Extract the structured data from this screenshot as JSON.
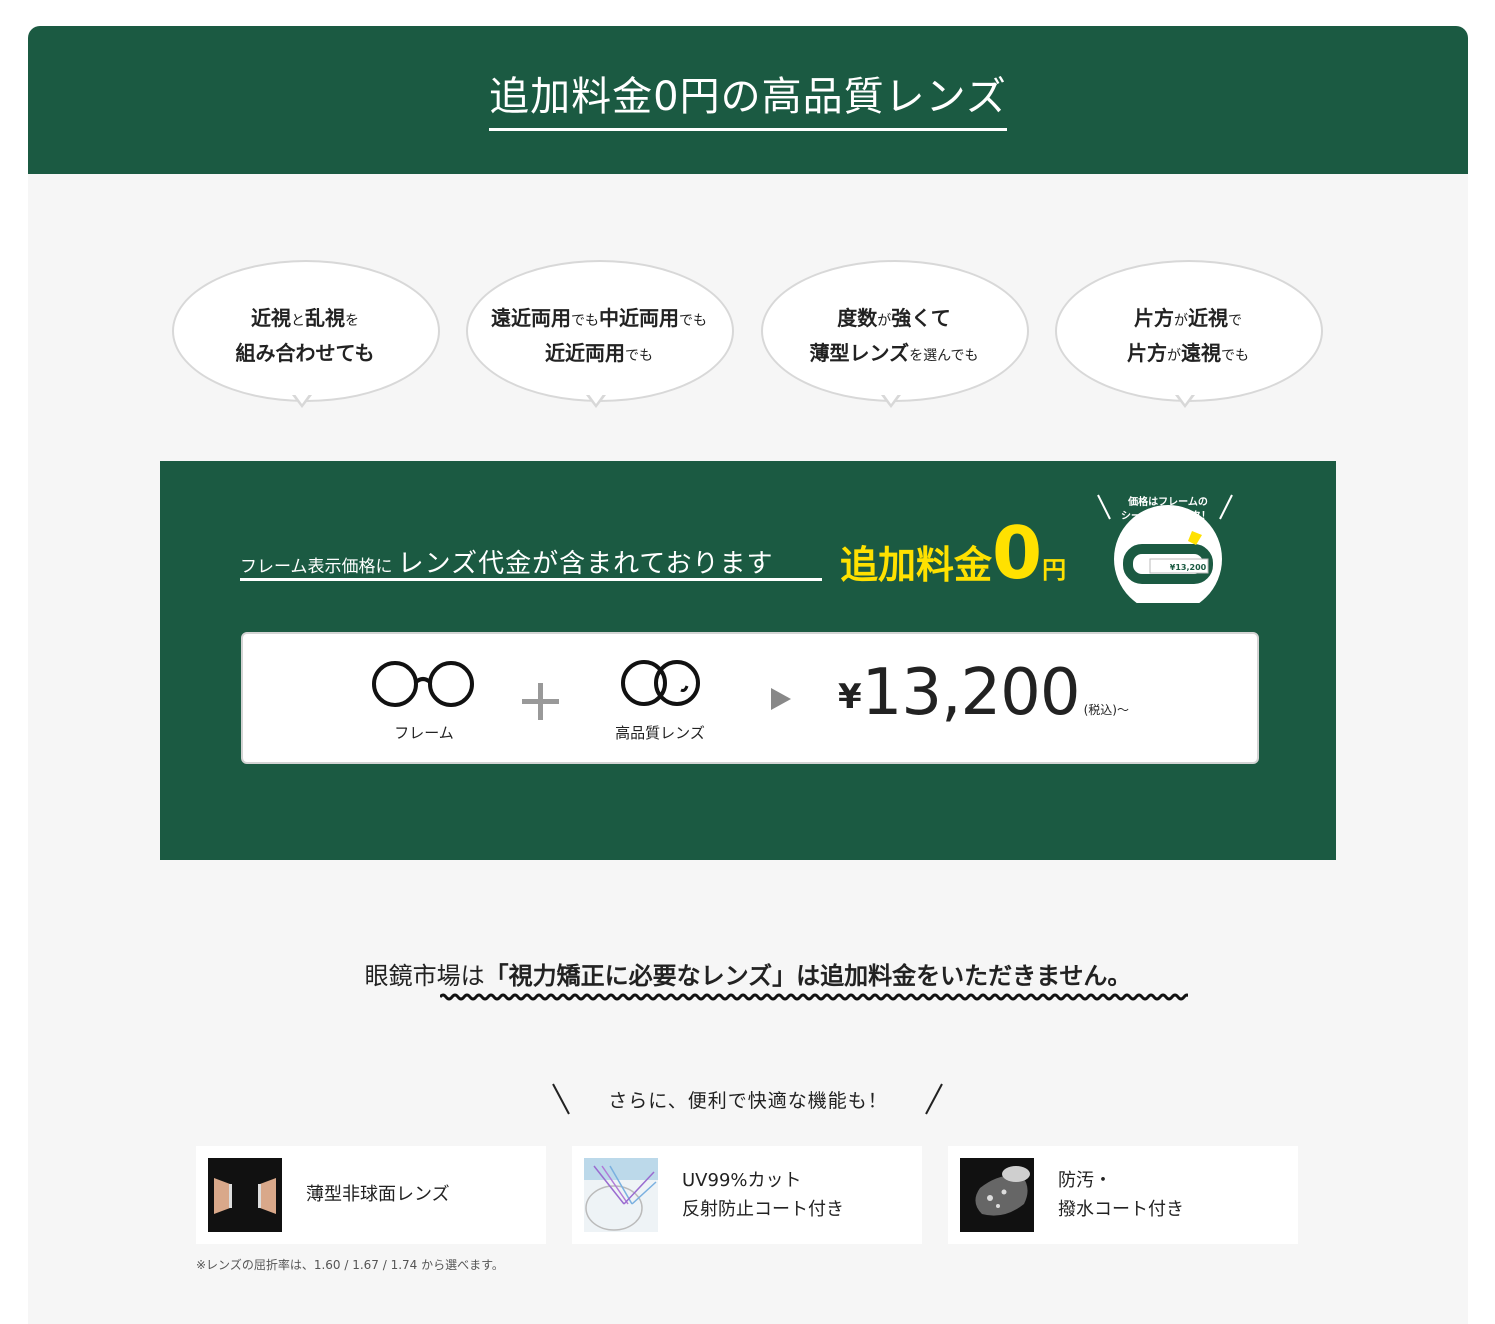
{
  "header": {
    "title": "追加料金0円の高品質レンズ"
  },
  "bubbles": [
    {
      "line1_a": "近視",
      "line1_b": "と",
      "line1_c": "乱視",
      "line1_d": "を",
      "line2_a": "組み合わせても",
      "line2_b": ""
    },
    {
      "line1_a": "遠近両用",
      "line1_b": "でも",
      "line1_c": "中近両用",
      "line1_d": "でも",
      "line2_a": "近近両用",
      "line2_b": "でも"
    },
    {
      "line1_a": "度数",
      "line1_b": "が",
      "line1_c": "強くて",
      "line1_d": "",
      "line2_a": "薄型レンズ",
      "line2_b": "を選んでも"
    },
    {
      "line1_a": "片方",
      "line1_b": "が",
      "line1_c": "近視",
      "line1_d": "で",
      "line2_a": "片方",
      "line2_b": "が",
      "line2_c": "遠視",
      "line2_d": "でも"
    }
  ],
  "promo": {
    "lead_small": "フレーム表示価格に",
    "lead_large": "レンズ代金が含まれております",
    "zero_a": "追加料金",
    "zero_b": "0",
    "zero_c": "円",
    "seal_line1": "価格はフレームの",
    "seal_line2": "シールをチェック！",
    "seal_price": "¥13,200",
    "frame_label": "フレーム",
    "lens_label": "高品質レンズ",
    "price_yen": "¥",
    "price_value": "13,200",
    "price_tax": "(税込)～"
  },
  "statement": {
    "prefix": "眼鏡市場は",
    "emphasis": "「視力矯正に必要なレンズ」は追加料金をいただきません。"
  },
  "features_heading": "さらに、便利で快適な機能も！",
  "features": [
    {
      "line1": "薄型非球面レンズ",
      "line2": ""
    },
    {
      "line1": "UV99%カット",
      "line2": "反射防止コート付き"
    },
    {
      "line1": "防汚・",
      "line2": "撥水コート付き"
    }
  ],
  "note": "※レンズの屈折率は、1.60 / 1.67 / 1.74 から選べます。",
  "colors": {
    "brand_green": "#1b5a42",
    "accent_yellow": "#ffe100",
    "panel_bg": "#f6f6f6"
  }
}
